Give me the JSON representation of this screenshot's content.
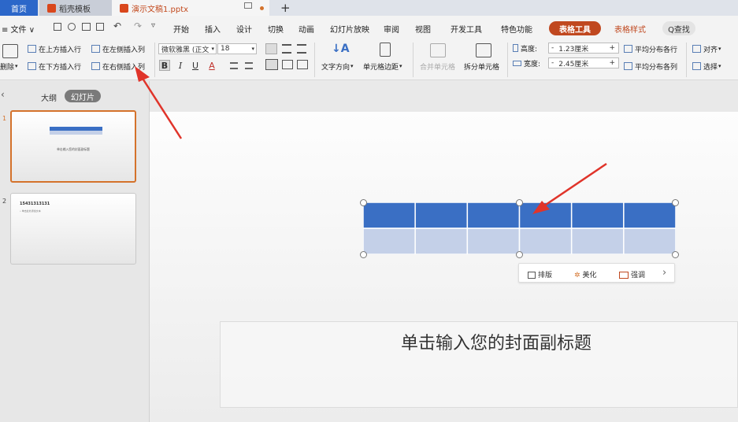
{
  "tabs": {
    "home": "首页",
    "template": "稻壳模板",
    "document": "演示文稿1.pptx",
    "new_tab": "+"
  },
  "menu": {
    "file": "≡ 文件 ∨",
    "items": [
      "开始",
      "插入",
      "设计",
      "切换",
      "动画",
      "幻灯片放映",
      "审阅",
      "视图",
      "开发工具",
      "特色功能"
    ],
    "table_tools": "表格工具",
    "table_style": "表格样式",
    "search": "Q查找"
  },
  "ribbon": {
    "insert_above": "在上方插入行",
    "insert_left": "在左侧插入列",
    "delete": "删除",
    "insert_below": "在下方插入行",
    "insert_right": "在右侧插入列",
    "font_name": "微软雅黑 (正文",
    "font_size": "18",
    "text_direction": "文字方向",
    "cell_margin": "单元格边距",
    "merge_cells": "合并单元格",
    "split_cells": "拆分单元格",
    "height_label": "高度:",
    "height_value": "1.23厘米",
    "width_label": "宽度:",
    "width_value": "2.45厘米",
    "distribute_rows": "平均分布各行",
    "distribute_cols": "平均分布各列",
    "align": "对齐",
    "select": "选择",
    "bold": "B",
    "italic": "I",
    "underline": "U",
    "font_color": "A"
  },
  "left_panel": {
    "close": "‹",
    "outline": "大纲",
    "slides": "幻灯片",
    "slide1_num": "1",
    "slide1_caption": "单击输入您的封面副标题",
    "slide2_num": "2",
    "slide2_title": "15431313131",
    "slide2_bullet": "• 单击此处添加文本"
  },
  "minitoolbar": {
    "layout": "排版",
    "beautify": "美化",
    "emphasize": "强调",
    "more": "›"
  },
  "slide": {
    "subtitle": "单击输入您的封面副标题"
  },
  "table": {
    "rows": 2,
    "cols": 6
  },
  "colors": {
    "accent": "#c0481f",
    "header_row": "#3a6fc4",
    "body_row": "#c4d0e8",
    "arrow": "#e0342a"
  }
}
